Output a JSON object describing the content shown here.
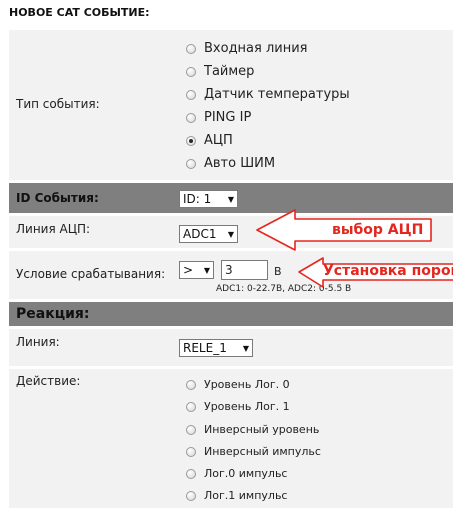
{
  "title": "НОВОЕ CAT СОБЫТИЕ:",
  "event_type": {
    "label": "Тип события:",
    "options": [
      {
        "label": "Входная линия",
        "selected": false
      },
      {
        "label": "Таймер",
        "selected": false
      },
      {
        "label": "Датчик температуры",
        "selected": false
      },
      {
        "label": "PING IP",
        "selected": false
      },
      {
        "label": "АЦП",
        "selected": true
      },
      {
        "label": "Авто ШИМ",
        "selected": false
      }
    ]
  },
  "event_id": {
    "label": "ID События:",
    "value": "ID: 1"
  },
  "adc_line": {
    "label": "Линия АЦП:",
    "value": "ADC1"
  },
  "trigger": {
    "label": "Условие срабатывания:",
    "operator": ">",
    "value": "3",
    "unit": "В",
    "hint": "ADC1: 0-22.7В, ADC2: 0-5.5 В"
  },
  "reaction": {
    "header": "Реакция:",
    "line_label": "Линия:",
    "line_value": "RELE_1",
    "action_label": "Действие:",
    "actions": [
      {
        "label": "Уровень Лог. 0",
        "selected": false
      },
      {
        "label": "Уровень Лог. 1",
        "selected": false
      },
      {
        "label": "Инверсный уровень",
        "selected": false
      },
      {
        "label": "Инверсный импульс",
        "selected": false
      },
      {
        "label": "Лог.0 импульс",
        "selected": false
      },
      {
        "label": "Лог.1 импульс",
        "selected": false
      }
    ]
  },
  "annotations": {
    "adc_choice": "выбор АЦП",
    "threshold": "Установка порог",
    "color": "#e5261e"
  },
  "colors": {
    "dark_band": "#7f7f7f",
    "light_band": "#f2f2f2"
  }
}
